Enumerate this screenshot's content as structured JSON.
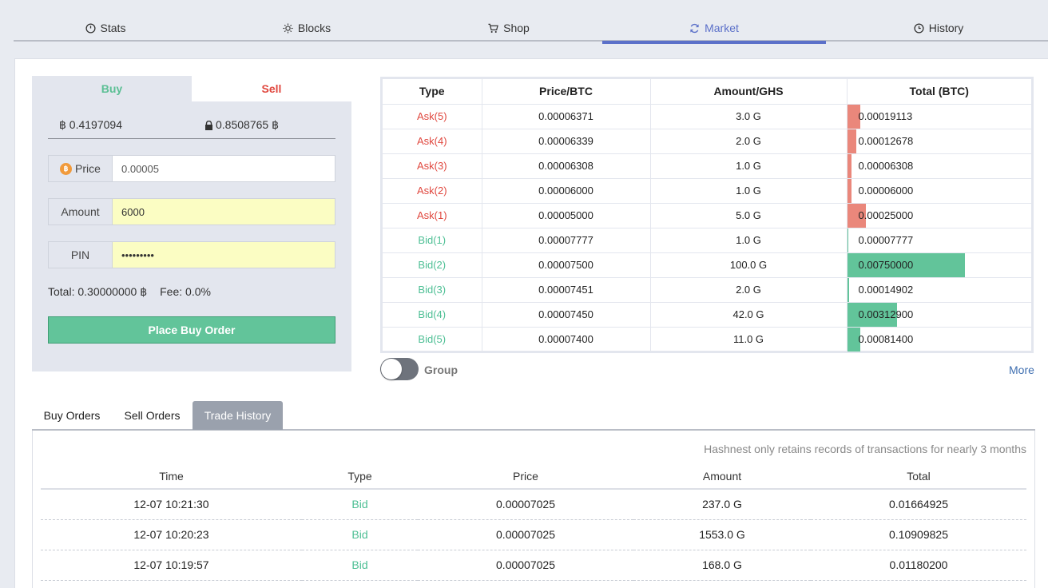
{
  "nav": {
    "tabs": [
      {
        "label": "Stats",
        "icon": "dashboard-icon"
      },
      {
        "label": "Blocks",
        "icon": "sun-icon"
      },
      {
        "label": "Shop",
        "icon": "cart-icon"
      },
      {
        "label": "Market",
        "icon": "refresh-icon",
        "active": true
      },
      {
        "label": "History",
        "icon": "clock-icon"
      }
    ]
  },
  "form": {
    "buy_tab": "Buy",
    "sell_tab": "Sell",
    "btc_balance": "฿ 0.4197094",
    "locked_balance": "0.8508765 ฿",
    "price_label": "Price",
    "price_value": "0.00005",
    "amount_label": "Amount",
    "amount_value": "6000",
    "pin_label": "PIN",
    "pin_value": "•••••••••",
    "total_text": "Total: 0.30000000 ฿",
    "fee_text": "Fee: 0.0%",
    "place_button": "Place Buy Order"
  },
  "book": {
    "headers": [
      "Type",
      "Price/BTC",
      "Amount/GHS",
      "Total (BTC)"
    ],
    "rows": [
      {
        "type": "Ask(5)",
        "side": "ask",
        "price": "0.00006371",
        "amount": "3.0 G",
        "total": "0.00019113",
        "depth": 0.07
      },
      {
        "type": "Ask(4)",
        "side": "ask",
        "price": "0.00006339",
        "amount": "2.0 G",
        "total": "0.00012678",
        "depth": 0.05
      },
      {
        "type": "Ask(3)",
        "side": "ask",
        "price": "0.00006308",
        "amount": "1.0 G",
        "total": "0.00006308",
        "depth": 0.025
      },
      {
        "type": "Ask(2)",
        "side": "ask",
        "price": "0.00006000",
        "amount": "1.0 G",
        "total": "0.00006000",
        "depth": 0.025
      },
      {
        "type": "Ask(1)",
        "side": "ask",
        "price": "0.00005000",
        "amount": "5.0 G",
        "total": "0.00025000",
        "depth": 0.1
      },
      {
        "type": "Bid(1)",
        "side": "bid",
        "price": "0.00007777",
        "amount": "1.0 G",
        "total": "0.00007777",
        "depth": 0.003
      },
      {
        "type": "Bid(2)",
        "side": "bid",
        "price": "0.00007500",
        "amount": "100.0 G",
        "total": "0.00750000",
        "depth": 0.64
      },
      {
        "type": "Bid(3)",
        "side": "bid",
        "price": "0.00007451",
        "amount": "2.0 G",
        "total": "0.00014902",
        "depth": 0.012
      },
      {
        "type": "Bid(4)",
        "side": "bid",
        "price": "0.00007450",
        "amount": "42.0 G",
        "total": "0.00312900",
        "depth": 0.27
      },
      {
        "type": "Bid(5)",
        "side": "bid",
        "price": "0.00007400",
        "amount": "11.0 G",
        "total": "0.00081400",
        "depth": 0.07
      }
    ],
    "group_label": "Group",
    "group_enabled": false,
    "more_link": "More"
  },
  "history": {
    "tabs": [
      "Buy Orders",
      "Sell Orders",
      "Trade History"
    ],
    "active_tab": "Trade History",
    "note": "Hashnest only retains records of transactions for nearly 3 months",
    "headers": [
      "Time",
      "Type",
      "Price",
      "Amount",
      "Total"
    ],
    "rows": [
      {
        "time": "12-07 10:21:30",
        "type": "Bid",
        "price": "0.00007025",
        "amount": "237.0 G",
        "total": "0.01664925"
      },
      {
        "time": "12-07 10:20:23",
        "type": "Bid",
        "price": "0.00007025",
        "amount": "1553.0 G",
        "total": "0.10909825"
      },
      {
        "time": "12-07 10:19:57",
        "type": "Bid",
        "price": "0.00007025",
        "amount": "168.0 G",
        "total": "0.01180200"
      }
    ]
  },
  "colors": {
    "ask": "#e0473e",
    "bid": "#4dbf94",
    "accent": "#5b70c9"
  }
}
